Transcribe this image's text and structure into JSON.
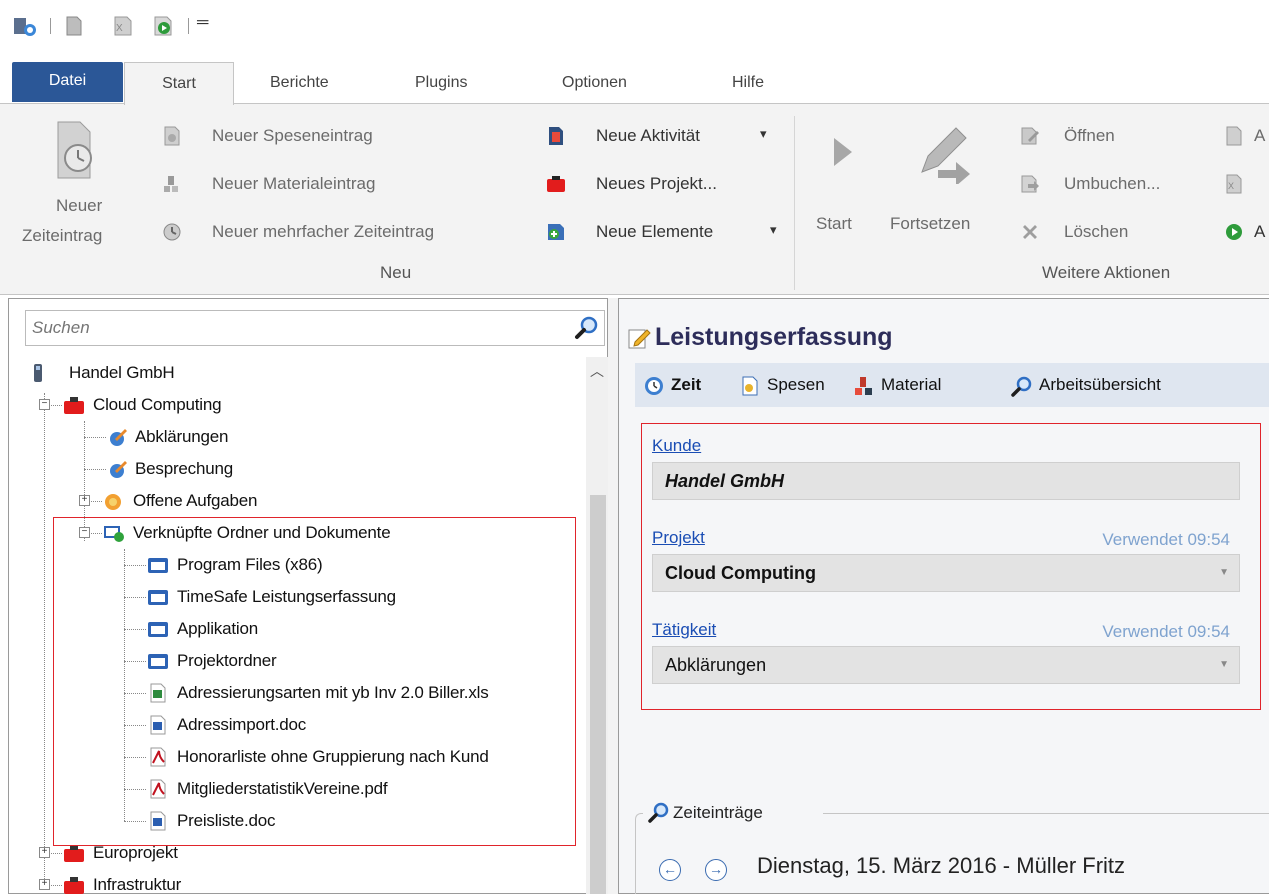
{
  "quick_access": {
    "icons": [
      "time-entry-icon",
      "page-icon",
      "excel-icon",
      "start-icon",
      "customize-icon"
    ],
    "customize_glyph": "═"
  },
  "tabs": [
    "Datei",
    "Start",
    "Berichte",
    "Plugins",
    "Optionen",
    "Hilfe"
  ],
  "active_tab": "Start",
  "ribbon": {
    "new_time_entry": [
      "Neuer",
      "Zeiteintrag"
    ],
    "new_expense": "Neuer Speseneintrag",
    "new_material": "Neuer Materialeintrag",
    "new_multi_time": "Neuer mehrfacher Zeiteintrag",
    "new_activity": "Neue Aktivität",
    "new_project": "Neues Projekt...",
    "new_elements": "Neue Elemente",
    "group_new": "Neu",
    "start": "Start",
    "continue": "Fortsetzen",
    "open": "Öffnen",
    "rebook": "Umbuchen...",
    "delete": "Löschen",
    "group_more": "Weitere Aktionen",
    "dropdown_glyph": "▾",
    "cut_letter": "A"
  },
  "search": {
    "placeholder": "Suchen"
  },
  "tree": {
    "root": "Handel GmbH",
    "nodes": [
      {
        "label": "Cloud Computing"
      },
      {
        "label": "Abklärungen"
      },
      {
        "label": "Besprechung"
      },
      {
        "label": "Offene Aufgaben"
      },
      {
        "label": "Verknüpfte Ordner und Dokumente"
      },
      {
        "label": "Program Files (x86)"
      },
      {
        "label": "TimeSafe Leistungserfassung"
      },
      {
        "label": "Applikation"
      },
      {
        "label": "Projektordner"
      },
      {
        "label": "Adressierungsarten mit yb Inv 2.0 Biller.xls"
      },
      {
        "label": "Adressimport.doc"
      },
      {
        "label": "Honorarliste ohne Gruppierung nach Kund"
      },
      {
        "label": "MitgliederstatistikVereine.pdf"
      },
      {
        "label": "Preisliste.doc"
      },
      {
        "label": "Europrojekt"
      },
      {
        "label": "Infrastruktur"
      }
    ]
  },
  "panel": {
    "title": "Leistungserfassung",
    "subtabs": [
      "Zeit",
      "Spesen",
      "Material",
      "Arbeitsübersicht"
    ],
    "active_subtab": "Zeit",
    "form": {
      "customer_label": "Kunde",
      "customer_value": "Handel GmbH",
      "project_label": "Projekt",
      "project_used": "Verwendet 09:54",
      "project_value": "Cloud Computing",
      "activity_label": "Tätigkeit",
      "activity_used": "Verwendet 09:54",
      "activity_value": "Abklärungen"
    },
    "entries_title": "Zeiteinträge",
    "date_label": "Dienstag, 15. März 2016 - Müller Fritz"
  },
  "colors": {
    "file_tab": "#2b5797",
    "highlight_border": "#e0242b",
    "link": "#1a4db4",
    "used_text": "#7fa3cf"
  }
}
